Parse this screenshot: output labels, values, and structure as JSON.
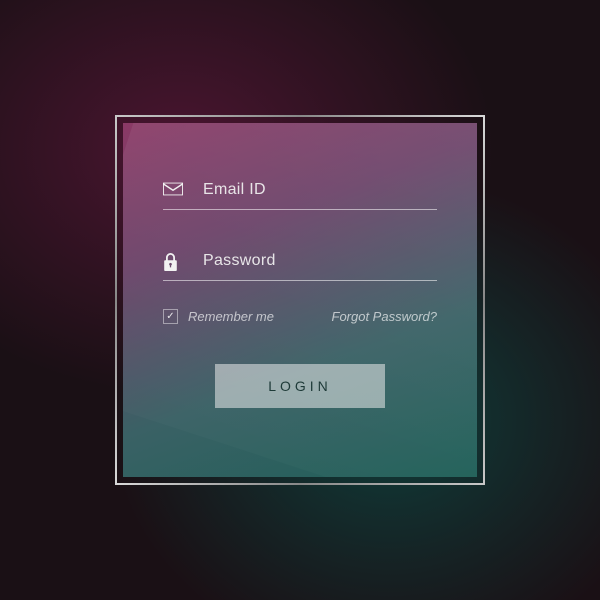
{
  "form": {
    "email_placeholder": "Email ID",
    "password_placeholder": "Password",
    "remember_label": "Remember me",
    "forgot_label": "Forgot Password?",
    "login_label": "LOGIN"
  }
}
